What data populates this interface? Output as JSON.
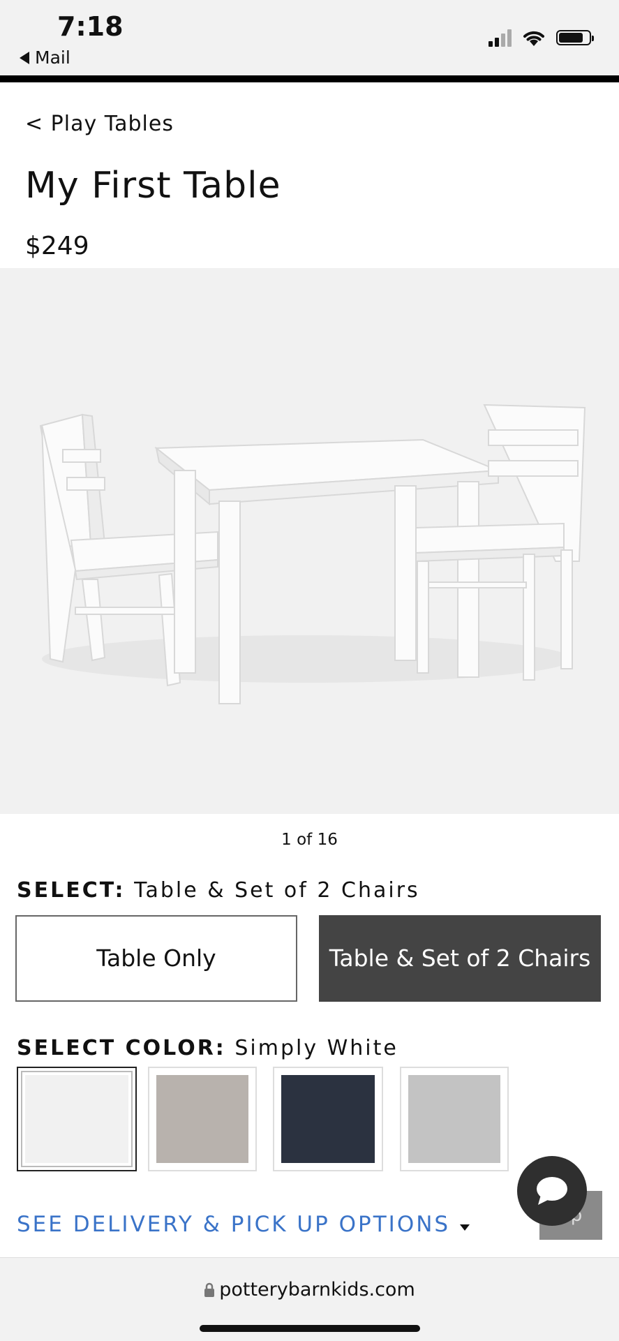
{
  "status_bar": {
    "time": "7:18",
    "back_app": "Mail"
  },
  "breadcrumb": "< Play Tables",
  "product": {
    "title": "My First Table",
    "price": "$249"
  },
  "gallery": {
    "pager": "1 of 16"
  },
  "configuration": {
    "label": "SELECT:",
    "selected": "Table & Set of 2 Chairs",
    "options": [
      "Table Only",
      "Table & Set of 2 Chairs"
    ]
  },
  "color": {
    "label": "SELECT COLOR:",
    "selected": "Simply White",
    "swatches": [
      {
        "name": "Simply White",
        "hex": "#f1f1f1"
      },
      {
        "name": "grey wash",
        "hex": "#b8b2ad"
      },
      {
        "name": "navy",
        "hex": "#2b3240"
      },
      {
        "name": "grey",
        "hex": "#c3c3c3"
      }
    ]
  },
  "delivery_link": "SEE DELIVERY & PICK UP OPTIONS",
  "top_button": "op",
  "browser": {
    "url": "potterybarnkids.com"
  },
  "colors": {
    "accent": "#3a73c8",
    "active_option": "#444444"
  }
}
